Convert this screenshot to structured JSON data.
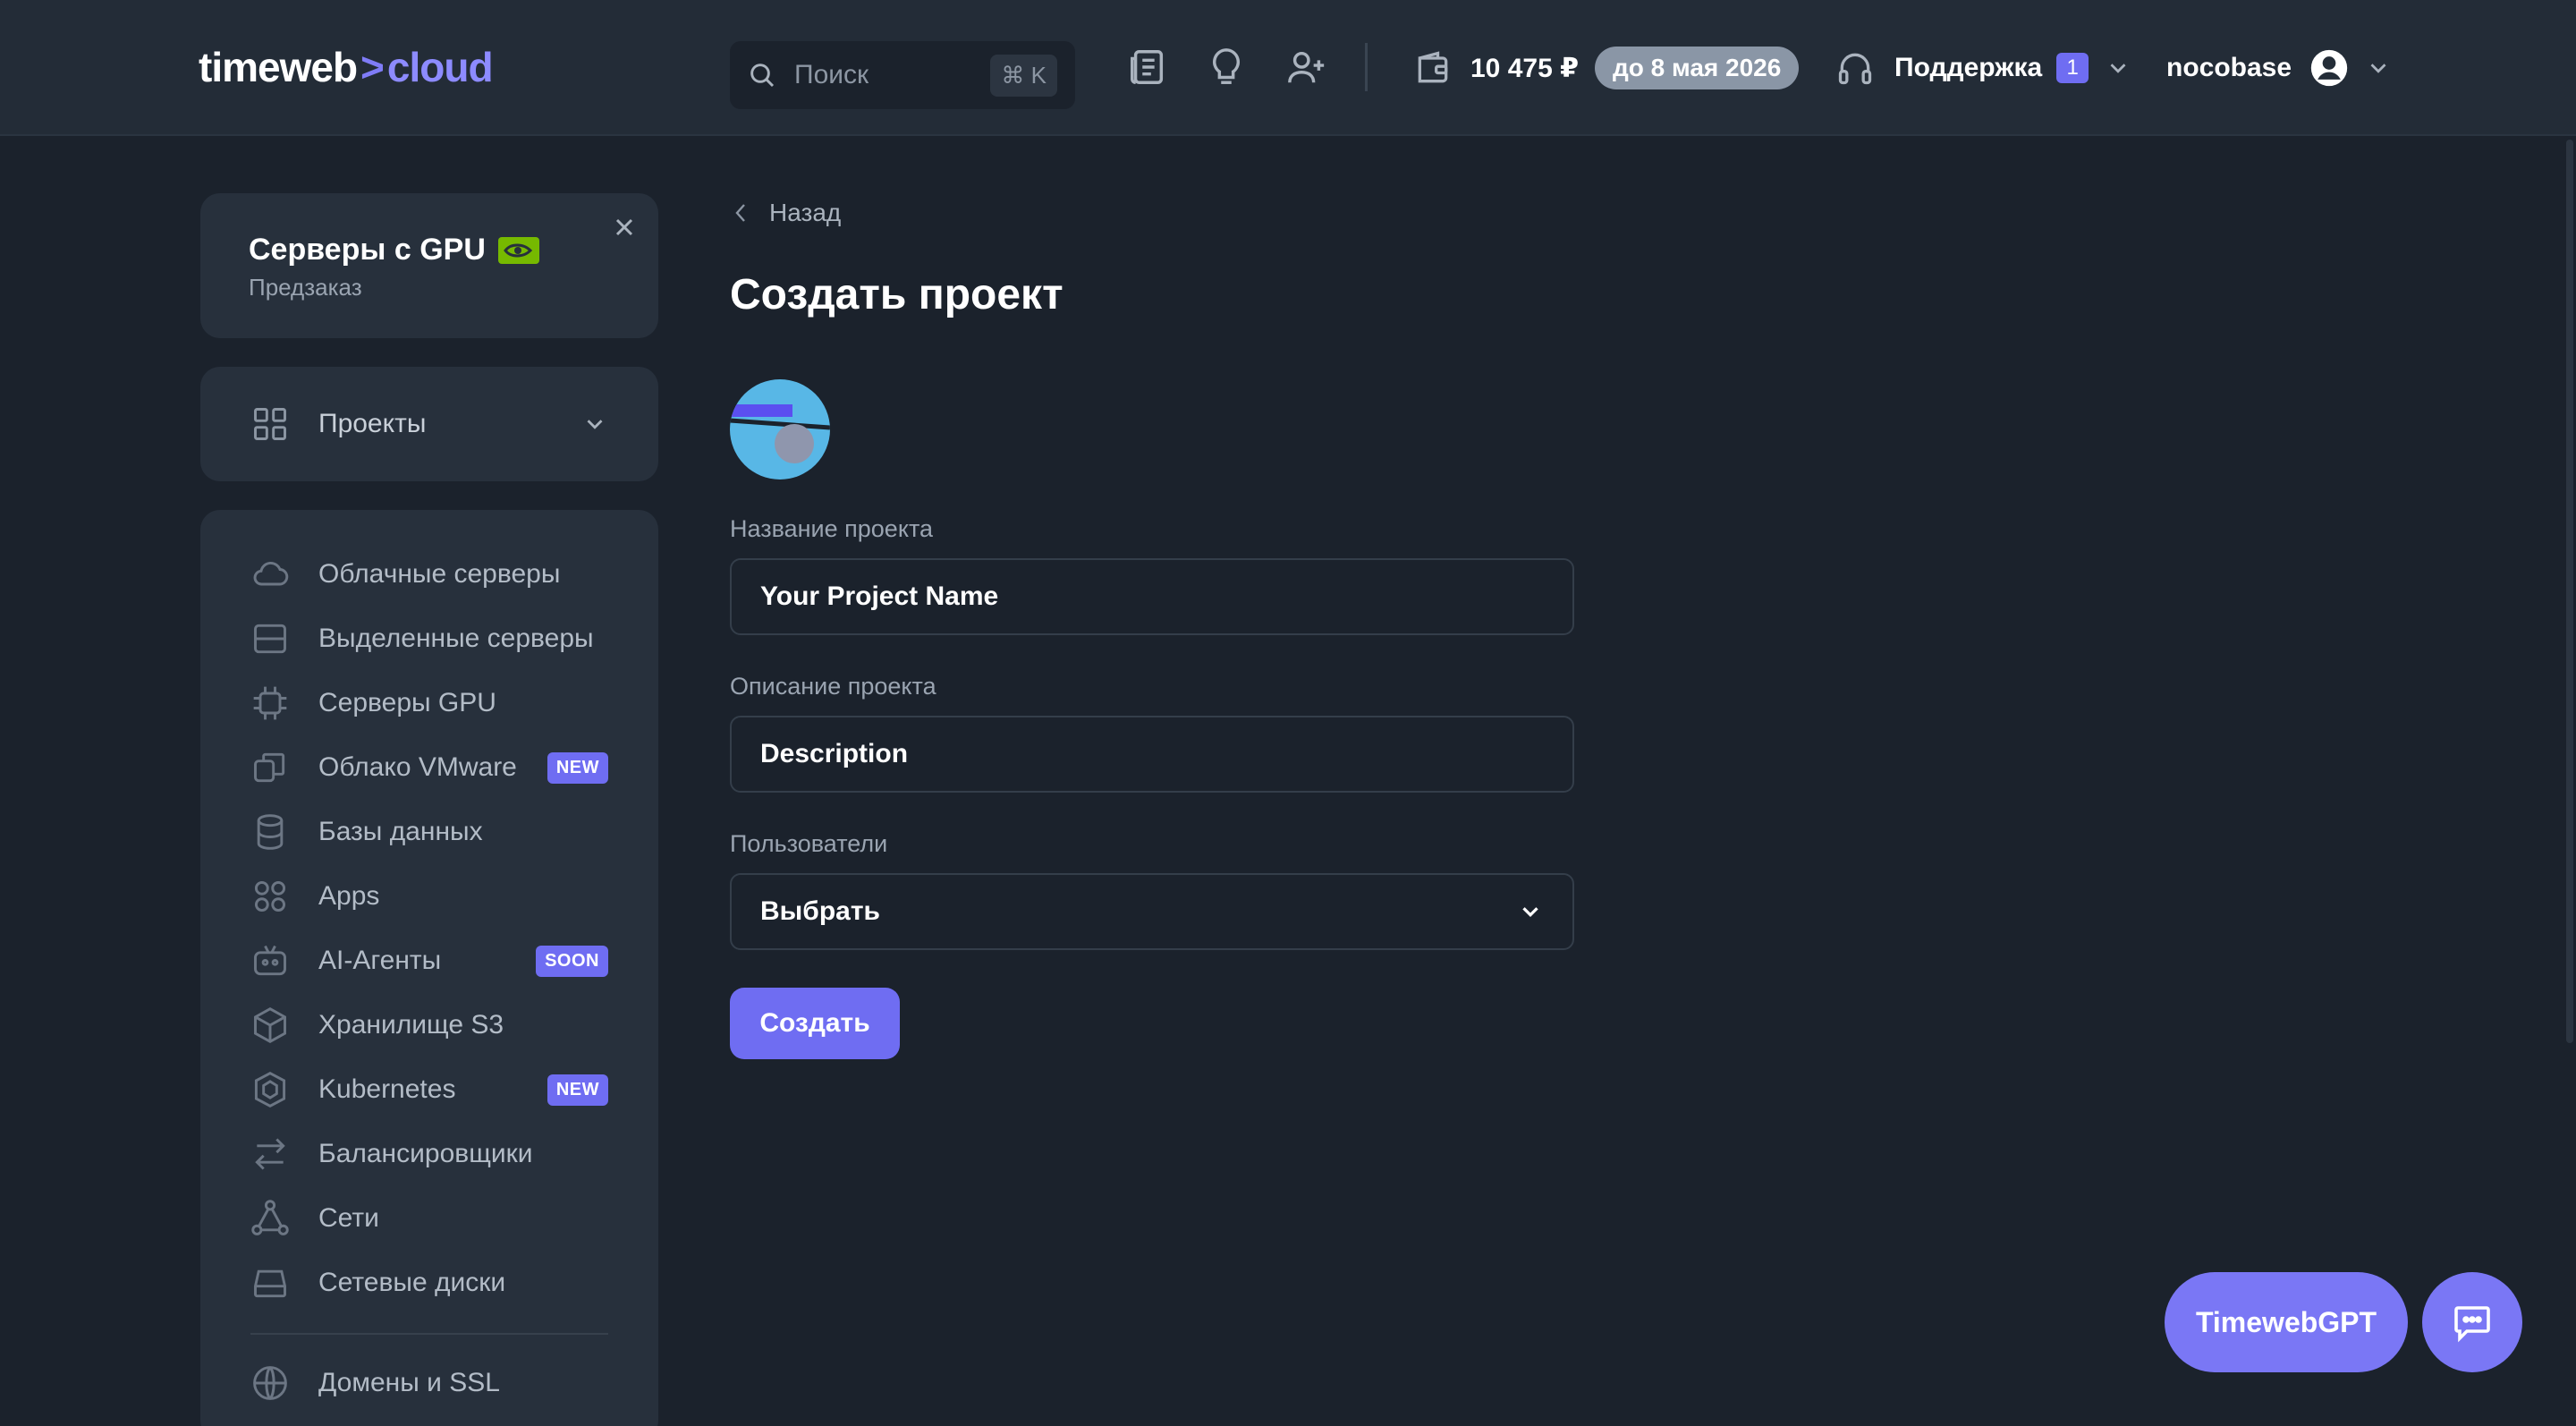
{
  "header": {
    "logo_main": "timeweb",
    "logo_arrow": ">",
    "logo_cloud": "cloud",
    "search_placeholder": "Поиск",
    "search_shortcut": "⌘ K",
    "balance": "10 475 ₽",
    "paid_until": "до 8 мая 2026",
    "support_label": "Поддержка",
    "support_count": "1",
    "username": "nocobase",
    "icons": [
      "news-icon",
      "lightbulb-icon",
      "add-user-icon",
      "wallet-icon",
      "headphones-icon",
      "user-avatar-icon"
    ]
  },
  "sidebar": {
    "promo": {
      "title": "Серверы с GPU",
      "subtitle": "Предзаказ"
    },
    "projects_label": "Проекты",
    "items": [
      {
        "label": "Облачные серверы",
        "icon": "cloud-icon",
        "tag": ""
      },
      {
        "label": "Выделенные серверы",
        "icon": "server-icon",
        "tag": ""
      },
      {
        "label": "Серверы GPU",
        "icon": "chip-icon",
        "tag": ""
      },
      {
        "label": "Облако VMware",
        "icon": "vmware-icon",
        "tag": "NEW"
      },
      {
        "label": "Базы данных",
        "icon": "database-icon",
        "tag": ""
      },
      {
        "label": "Apps",
        "icon": "apps-icon",
        "tag": ""
      },
      {
        "label": "AI-Агенты",
        "icon": "robot-icon",
        "tag": "SOON"
      },
      {
        "label": "Хранилище S3",
        "icon": "box-icon",
        "tag": ""
      },
      {
        "label": "Kubernetes",
        "icon": "kubernetes-icon",
        "tag": "NEW"
      },
      {
        "label": "Балансировщики",
        "icon": "arrows-icon",
        "tag": ""
      },
      {
        "label": "Сети",
        "icon": "network-icon",
        "tag": ""
      },
      {
        "label": "Сетевые диски",
        "icon": "disk-icon",
        "tag": ""
      }
    ],
    "extra_item": {
      "label": "Домены и SSL",
      "icon": "globe-icon"
    }
  },
  "main": {
    "back_label": "Назад",
    "title": "Создать проект",
    "name_label": "Название проекта",
    "name_value": "Your Project Name",
    "description_label": "Описание проекта",
    "description_value": "Description",
    "users_label": "Пользователи",
    "users_value": "Выбрать",
    "create_button": "Создать"
  },
  "floating": {
    "gpt_label": "TimewebGPT"
  },
  "colors": {
    "accent": "#6f6df2",
    "background": "#1b222c",
    "panel": "#27303c",
    "topbar": "#232c37"
  }
}
